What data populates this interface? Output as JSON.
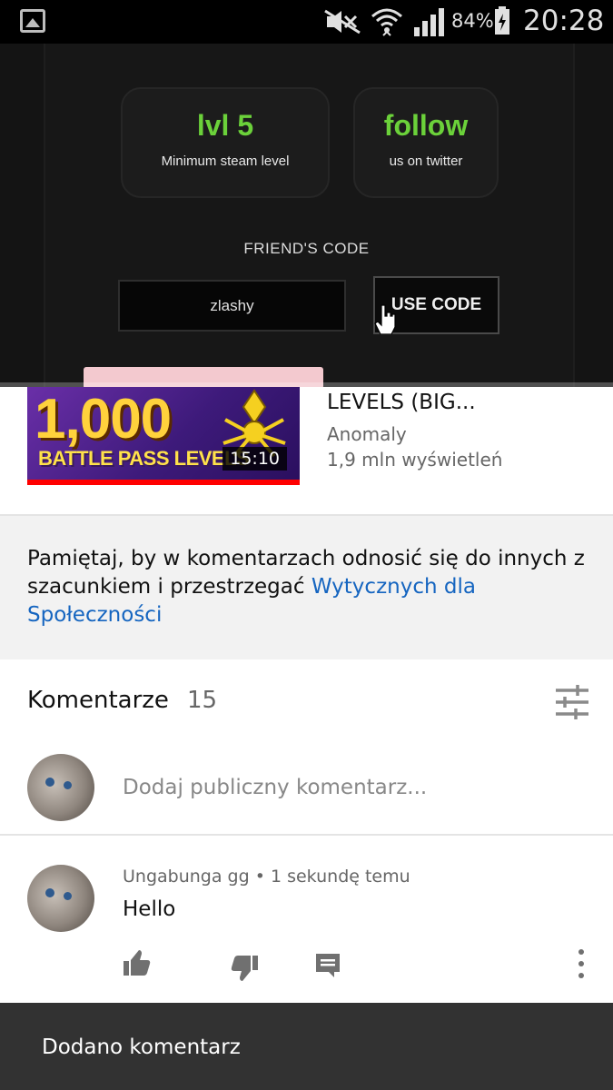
{
  "status_bar": {
    "battery_percent": "84%",
    "clock": "20:28",
    "icons": [
      "gallery-icon",
      "mute-icon",
      "wifi-icon",
      "signal-icon",
      "battery-charging-icon"
    ]
  },
  "player": {
    "card_level": {
      "value": "lvl 5",
      "caption": "Minimum steam level"
    },
    "card_follow": {
      "value": "follow",
      "caption": "us on twitter"
    },
    "friends_code_label": "FRIEND'S CODE",
    "code_input_value": "zlashy",
    "use_code_label": "USE CODE",
    "accent_color": "#6bd13a",
    "progress": 0.0
  },
  "up_next": {
    "thumbnail_big_text": "1,000",
    "thumbnail_small_text": "BATTLE PASS LEVELS",
    "duration": "15:10",
    "title": "LEVELS (BIG...",
    "channel": "Anomaly",
    "views": "1,9 mln wyświetleń"
  },
  "notice": {
    "text": "Pamiętaj, by w komentarzach odnosić się do innych z szacunkiem i przestrzegać ",
    "link_text": "Wytycznych dla Społeczności"
  },
  "comments": {
    "header_label": "Komentarze",
    "count": "15",
    "add_placeholder": "Dodaj publiczny komentarz...",
    "items": [
      {
        "author": "Ungabunga gg",
        "time": "1 sekundę temu",
        "text": "Hello"
      }
    ]
  },
  "snackbar": {
    "text": "Dodano komentarz"
  }
}
